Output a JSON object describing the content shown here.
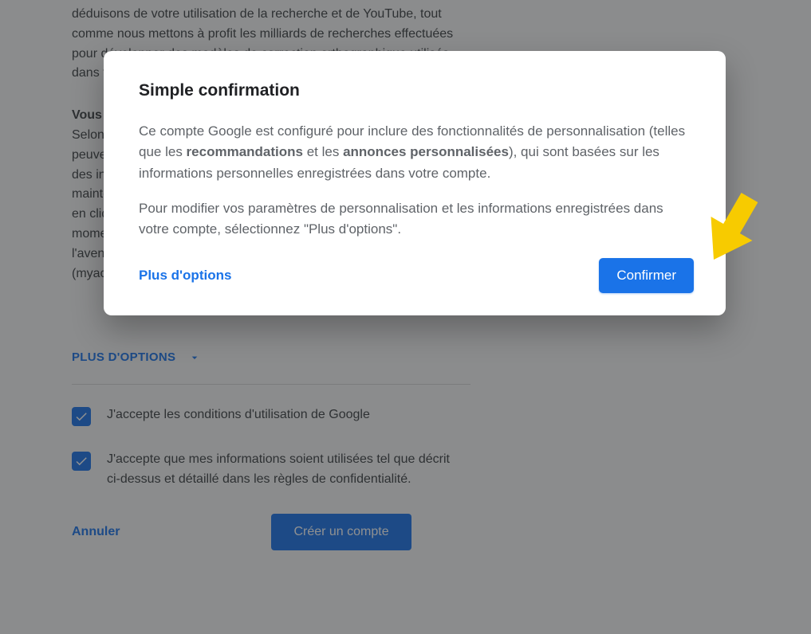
{
  "background": {
    "paragraph_intro": "déduisons de votre utilisation de la recherche et de YouTube, tout comme nous mettons à profit les milliards de recherches effectuées pour développer des modèles de correction orthographique utilisés dans tous nos services.",
    "control_heading": "Vous contrôlez vos données",
    "control_body": "Selon les paramètres de votre compte, certaines de ces données peuvent être associées à votre compte Google et traitées comme des informations personnelles. Vous pouvez contrôler dès maintenant la façon dont nous collectons et utilisons ces données en cliquant sur \"Plus d'options\" ci-dessous. Vous pourrez à tout moment ajuster les paramètres ou retirer votre consentement pour l'avenir en accédant à la page Mon compte (myaccount.google.com).",
    "more_options_label": "PLUS D'OPTIONS",
    "checkbox1_label": "J'accepte les conditions d'utilisation de Google",
    "checkbox2_label": "J'accepte que mes informations soient utilisées tel que décrit ci-dessus et détaillé dans les règles de confidentialité.",
    "cancel_label": "Annuler",
    "create_label": "Créer un compte"
  },
  "dialog": {
    "title": "Simple confirmation",
    "p1_before_rec": "Ce compte Google est configuré pour inclure des fonctionnalités de personnalisation (telles que les ",
    "rec_bold": "recommandations",
    "p1_between": " et les ",
    "ads_bold": "annonces personnalisées",
    "p1_after": "), qui sont basées sur les informations personnelles enregistrées dans votre compte.",
    "p2": "Pour modifier vos paramètres de personnalisation et les informations enregistrées dans votre compte, sélectionnez \"Plus d'options\".",
    "more_link": "Plus d'options",
    "confirm_label": "Confirmer"
  },
  "icons": {
    "chevron_down": "chevron-down-icon",
    "check": "check-icon",
    "pointer": "yellow-arrow-icon"
  },
  "colors": {
    "accent": "#1a73e8",
    "text_primary": "#202124",
    "text_secondary": "#5f6368",
    "highlight": "#f7cb00"
  }
}
